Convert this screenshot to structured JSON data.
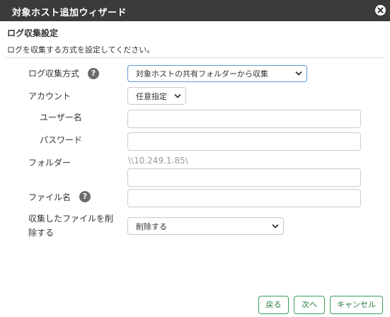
{
  "dialog": {
    "title": "対象ホスト追加ウィザード",
    "close_icon": "close-circle-icon"
  },
  "section": {
    "title": "ログ収集設定",
    "description": "ログを収集する方式を設定してください。"
  },
  "form": {
    "method": {
      "label": "ログ収集方式",
      "help": "?",
      "value": "対象ホストの共有フォルダーから収集"
    },
    "account": {
      "label": "アカウント",
      "value": "任意指定"
    },
    "username": {
      "label": "ユーザー名",
      "value": ""
    },
    "password": {
      "label": "パスワード",
      "value": ""
    },
    "folder": {
      "label": "フォルダー",
      "prefix": "\\\\10.249.1.85\\",
      "value": ""
    },
    "filename": {
      "label": "ファイル名",
      "help": "?",
      "value": ""
    },
    "delete": {
      "label_line1": "収集したファイルを削",
      "label_line2": "除する",
      "value": "削除する"
    }
  },
  "footer": {
    "back": "戻る",
    "next": "次へ",
    "cancel": "キャンセル"
  },
  "colors": {
    "titlebar": "#3b3b3b",
    "button_accent": "#3a9f5a",
    "focus": "#5b9bd5"
  }
}
